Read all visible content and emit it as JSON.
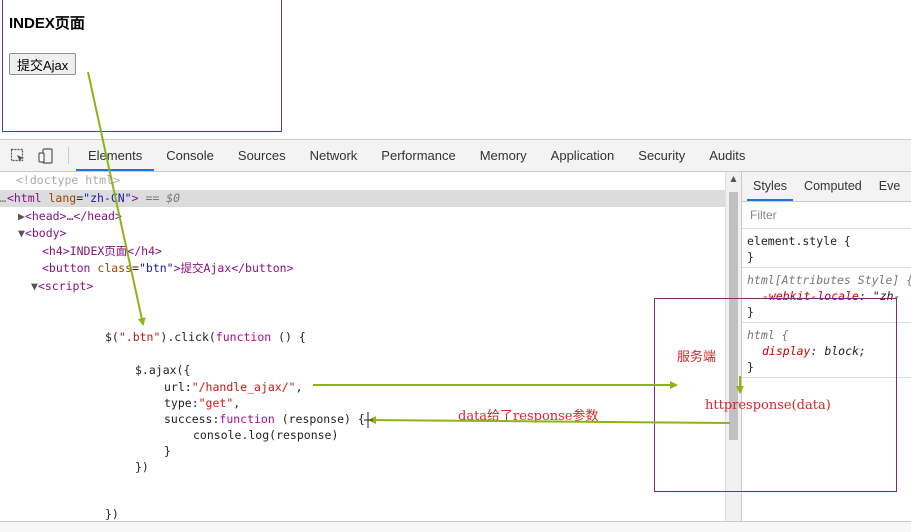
{
  "page": {
    "title": "INDEX页面",
    "button_label": "提交Ajax"
  },
  "devtools": {
    "tabs": [
      "Elements",
      "Console",
      "Sources",
      "Network",
      "Performance",
      "Memory",
      "Application",
      "Security",
      "Audits"
    ],
    "active_tab": "Elements",
    "dom": {
      "doctype": "<!doctype html>",
      "html_open": "<html",
      "html_lang_attr": "lang",
      "html_lang_val": "\"zh-CN\"",
      "html_close_bracket": ">",
      "selected_marker": " == $0",
      "head": "<head>…</head>",
      "body_open": "<body>",
      "h4": "<h4>INDEX页面</h4>",
      "button_open": "<button",
      "button_class_attr": "class",
      "button_class_val": "\"btn\"",
      "button_text": ">提交Ajax</button>",
      "script_open": "<script>"
    },
    "code": {
      "l1_a": "$(",
      "l1_str": "\".btn\"",
      "l1_b": ").click(",
      "l1_kw": "function",
      "l1_c": " () {",
      "l2": "$.ajax({",
      "l3_a": "url:",
      "l3_str": "\"/handle_ajax/\"",
      "l3_b": ",",
      "l4_a": "type:",
      "l4_str": "\"get\"",
      "l4_b": ",",
      "l5_a": "success:",
      "l5_kw": "function",
      "l5_b": " (response) {",
      "l6": "console.log(response)",
      "l7": "}",
      "l8": "})",
      "l9": "})"
    },
    "styles_tabs": [
      "Styles",
      "Computed",
      "Eve"
    ],
    "filter_placeholder": "Filter",
    "rules": {
      "r1_sel": "element.style {",
      "r1_close": "}",
      "r2_sel": "html[Attributes Style] {",
      "r2_prop": "-webkit-locale",
      "r2_val": ": \"zh-",
      "r2_close": "}",
      "r3_sel": "html {",
      "r3_prop": "display",
      "r3_val": ": block;",
      "r3_close": "}"
    }
  },
  "annotations": {
    "server": "服务端",
    "data_to_response": "data给了response参数",
    "httpresponse": "httpresponse(data)"
  },
  "colors": {
    "arrow": "#8db318",
    "annotation_text": "#d9262a",
    "box_border": "#7b2d6f",
    "tab_underline": "#1a73e8"
  }
}
